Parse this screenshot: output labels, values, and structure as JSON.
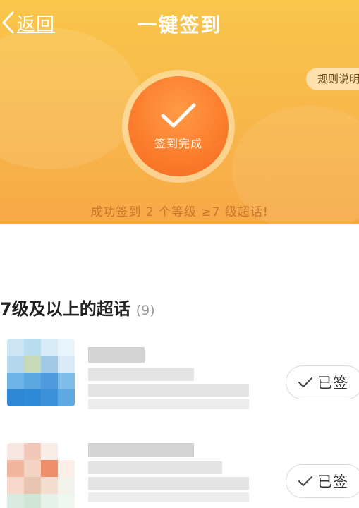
{
  "header": {
    "back_label": "返回",
    "title": "一键签到",
    "rules_label": "规则说明"
  },
  "checkin": {
    "status_text": "签到完成",
    "result_message": "成功签到 2 个等级 ≥7 级超话!"
  },
  "section": {
    "title": "7级及以上的超话",
    "count": "(9)"
  },
  "topics": [
    {
      "button_label": "已签"
    },
    {
      "button_label": "已签"
    }
  ],
  "colors": {
    "hero_top": "#f9c64a",
    "hero_bottom": "#f7a948",
    "badge": "#fb7b2c",
    "result_text": "#c7762a"
  },
  "icons": [
    "back-chevron-icon",
    "checkmark-icon",
    "check-small-icon"
  ]
}
